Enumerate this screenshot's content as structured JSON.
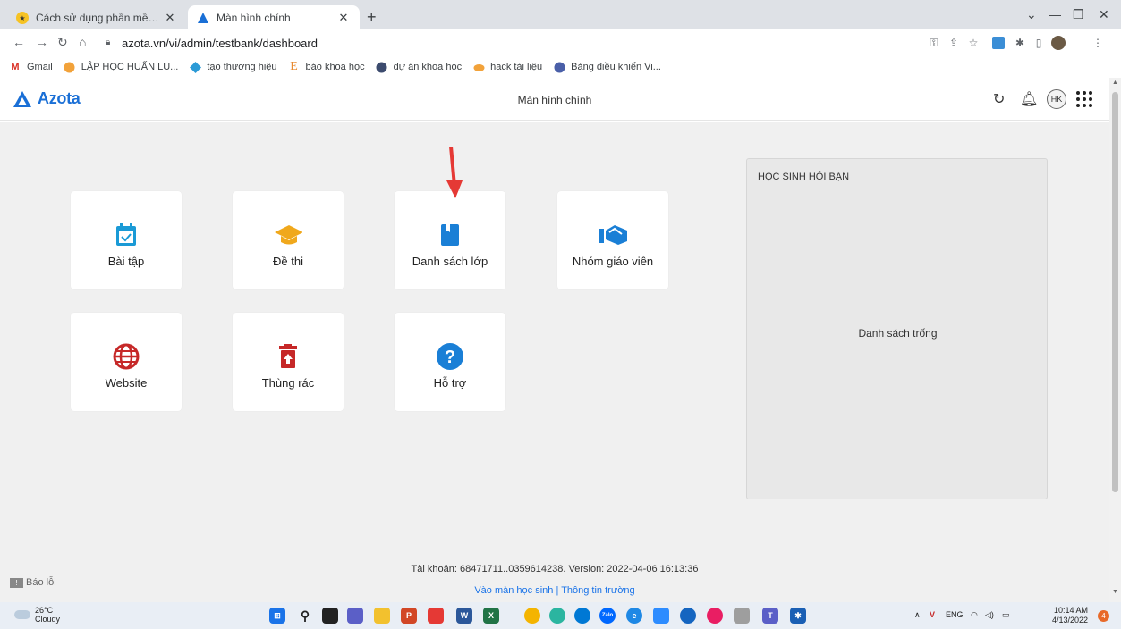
{
  "browser": {
    "tabs": [
      {
        "title": "Cách sử dụng phần mềm Azota |",
        "icon": "azota-star-icon"
      },
      {
        "title": "Màn hình chính",
        "icon": "azota-logo-icon"
      }
    ],
    "url": "azota.vn/vi/admin/testbank/dashboard",
    "bookmarks": [
      {
        "label": "Gmail",
        "icon": "gmail-icon"
      },
      {
        "label": "LẬP HỌC HUẤN LU...",
        "icon": "book-folder-icon"
      },
      {
        "label": "tạo thương hiệu",
        "icon": "diamond-icon"
      },
      {
        "label": "báo khoa học",
        "icon": "letter-e-icon"
      },
      {
        "label": "dự án khoa học",
        "icon": "globe-icon"
      },
      {
        "label": "hack tài liệu",
        "icon": "bird-icon"
      },
      {
        "label": "Bảng điều khiển Vi...",
        "icon": "dashboard-icon"
      }
    ]
  },
  "app": {
    "logo": "Azota",
    "title": "Màn hình chính",
    "avatar": "HK"
  },
  "tiles": [
    {
      "label": "Bài tập",
      "icon": "calendar-check-icon",
      "color": "#1a9ad6"
    },
    {
      "label": "Đề thi",
      "icon": "graduation-cap-icon",
      "color": "#f0a81c"
    },
    {
      "label": "Danh sách lớp",
      "icon": "bookmark-book-icon",
      "color": "#1a7fd6"
    },
    {
      "label": "Nhóm giáo viên",
      "icon": "handshake-icon",
      "color": "#1a7fd6"
    },
    {
      "label": "Website",
      "icon": "globe-icon",
      "color": "#c62828"
    },
    {
      "label": "Thùng rác",
      "icon": "trash-icon",
      "color": "#c62828"
    },
    {
      "label": "Hỗ trợ",
      "icon": "question-icon",
      "color": "#1a7fd6"
    }
  ],
  "panel": {
    "heading": "HỌC SINH HỎI BẠN",
    "empty": "Danh sách trống"
  },
  "footer": {
    "info": "Tài khoản: 68471711..0359614238. Version: 2022-04-06 16:13:36",
    "link_student": "Vào màn học sinh",
    "separator": "|",
    "link_school": "Thông tin trường",
    "report": "Báo lỗi"
  },
  "taskbar": {
    "temp": "26°C",
    "weather": "Cloudy",
    "lang": "ENG",
    "time": "10:14 AM",
    "date": "4/13/2022"
  },
  "colors": {
    "accent": "#1a73e8",
    "arrow": "#e53935"
  }
}
